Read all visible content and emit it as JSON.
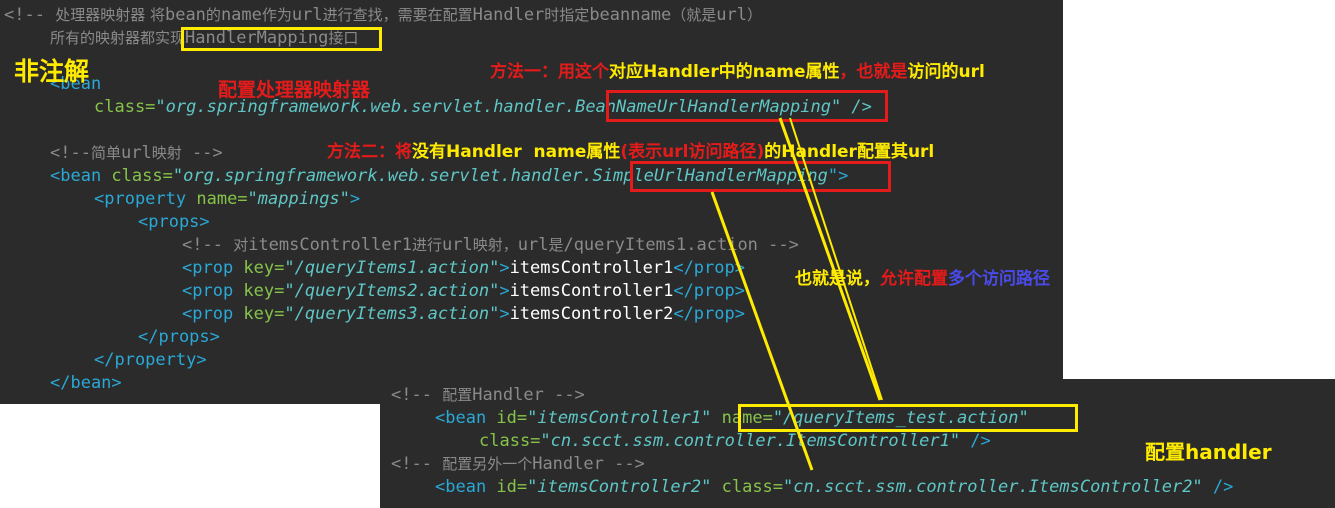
{
  "colors": {
    "editor_bg": "#2b2b2b",
    "tag": "#2aa8d6",
    "attr": "#86c34a",
    "string": "#5fc6c6",
    "comment": "#8a8a8a",
    "highlight_yellow": "#ffeb00",
    "highlight_red": "#e41b1b",
    "note_blue": "#4a4ae8"
  },
  "top": {
    "l1_a": "<!-- ",
    "l1_b": "处理器映射器 将",
    "l1_c": "bean",
    "l1_d": "的",
    "l1_e": "name",
    "l1_f": "作为",
    "l1_g": "url",
    "l1_h": "进行查找，需要在配置",
    "l1_i": "Handler",
    "l1_j": "时指定",
    "l1_k": "beanname",
    "l1_l": "（就是",
    "l1_m": "url",
    "l1_n": "）",
    "l2_a": "所有的映射器都实现",
    "l2_b": "HandlerMapping",
    "l2_c": "接口",
    "l4_tag": "<bean",
    "l5_attr": "class=",
    "l5_q": "\"",
    "l5_pkg": "org.springframework.web.servlet.handler.",
    "l5_cls": "BeanNameUrlHandlerMapping",
    "l5_end": "\" />",
    "l7_a": "<!--",
    "l7_b": "简单",
    "l7_c": "url",
    "l7_d": "映射",
    "l7_e": " -->",
    "l8_tag": "<bean",
    "l8_attr": " class=",
    "l8_q": "\"",
    "l8_pkg": "org.springframework.web.servlet.handler.",
    "l8_cls": "SimpleUrlHandlerMapping",
    "l8_end": "\">",
    "l9_tag": "<property",
    "l9_attr": " name=",
    "l9_val": "\"mappings\"",
    "l9_end": ">",
    "l10_tag": "<props>",
    "l11_a": "<!-- ",
    "l11_b": "对",
    "l11_c": "itemsController1",
    "l11_d": "进行",
    "l11_e": "url",
    "l11_f": "映射，",
    "l11_g": "url",
    "l11_h": "是",
    "l11_i": "/queryItems1.action -->",
    "props": [
      {
        "key_val": "\"/queryItems1.action\"",
        "text": "itemsController1"
      },
      {
        "key_val": "\"/queryItems2.action\"",
        "text": "itemsController1"
      },
      {
        "key_val": "\"/queryItems3.action\"",
        "text": "itemsController2"
      }
    ],
    "prop_open": "<prop",
    "prop_key": " key=",
    "prop_gt": ">",
    "prop_close": "</prop>",
    "l15": "</props>",
    "l16": "</property>",
    "l17": "</bean>"
  },
  "bottom": {
    "b1_a": "<!-- ",
    "b1_b": "配置",
    "b1_c": "Handler -->",
    "b2_tag": "<bean",
    "b2_attr": " id=",
    "b2_val": "\"itemsController1\"",
    "b2_name_attr": "name=",
    "b2_name_val": "\"/queryItems_test.action\"",
    "b3_attr": "class=",
    "b3_val": "\"cn.scct.ssm.controller.ItemsController1\"",
    "b3_end": " />",
    "b4_a": "<!-- ",
    "b4_b": "配置另外一个",
    "b4_c": "Handler -->",
    "b5_tag": "<bean",
    "b5_attr": " id=",
    "b5_val": "\"itemsController2\"",
    "b5_attr2": " class=",
    "b5_val2": "\"cn.scct.ssm.controller.ItemsController2\"",
    "b5_end": " />"
  },
  "notes": {
    "fei_zhujie": "非注解",
    "pz_mapper": "配置处理器映射器",
    "m1_a": "方法一：用这个",
    "m1_b": "对应Handler中的name属性",
    "m1_c": "，也就是",
    "m1_d": "访问的url",
    "m2_a": "方法二：将",
    "m2_b": "没有Handler  name属性",
    "m2_c": "(表示url访问路径)",
    "m2_d": "的Handler配置其url",
    "also_a": "也就是说，",
    "also_b": "允许配置",
    "also_c": "多个访问路径",
    "pz_handler": "配置handler"
  }
}
